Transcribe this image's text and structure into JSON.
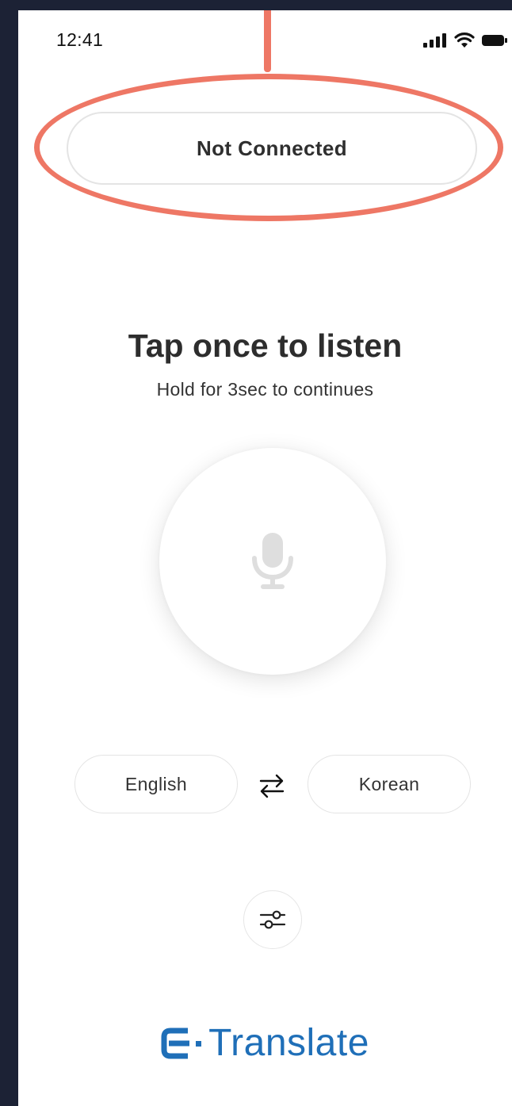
{
  "status_bar": {
    "time": "12:41"
  },
  "connection": {
    "status": "Not Connected"
  },
  "instructions": {
    "title": "Tap once to listen",
    "subtitle": "Hold for 3sec to continues"
  },
  "mic": {
    "icon": "microphone-icon"
  },
  "languages": {
    "source": "English",
    "target": "Korean",
    "swap_icon": "swap-arrows-icon"
  },
  "settings": {
    "icon": "sliders-icon"
  },
  "brand": {
    "name": "Translate",
    "logo_icon": "e-logo-icon",
    "color": "#1f6fb8"
  },
  "colors": {
    "callout": "#ee7765",
    "background": "#1c2235"
  }
}
